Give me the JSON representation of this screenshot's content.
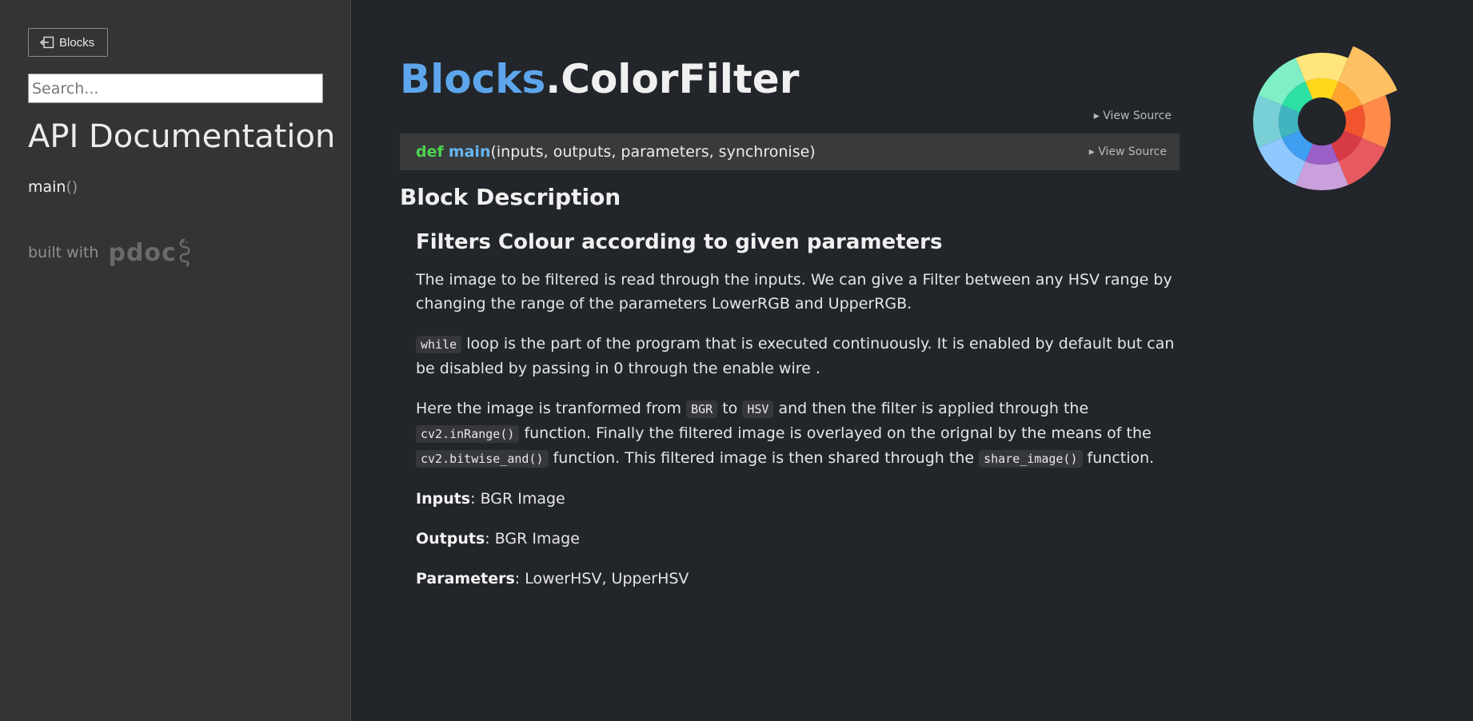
{
  "sidebar": {
    "back_label": "Blocks",
    "search_placeholder": "Search...",
    "title": "API Documentation",
    "nav_main": "main",
    "nav_main_parens": "()",
    "built_with": "built with",
    "logo_text": "pdoc"
  },
  "module": {
    "package": "Blocks",
    "dot": ".",
    "name": "ColorFilter",
    "view_source": "View Source"
  },
  "function": {
    "keyword": "def",
    "name": "main",
    "params": "(inputs, outputs, parameters, synchronise)",
    "view_source": "View Source"
  },
  "docs": {
    "section_title": "Block Description",
    "heading": "Filters Colour according to given parameters",
    "p1": "The image to be filtered is read through the inputs. We can give a Filter between any HSV range by changing the range of the parameters LowerRGB and UpperRGB.",
    "p2_code": "while",
    "p2_text": " loop is the part of the program that is executed continuously. It is enabled by default but can be disabled by passing in 0 through the enable wire .",
    "p3_a": "Here the image is tranformed from ",
    "p3_code1": "BGR",
    "p3_b": " to ",
    "p3_code2": "HSV",
    "p3_c": " and then the filter is applied through the ",
    "p3_code3": "cv2.inRange()",
    "p3_d": " function. Finally the filtered image is overlayed on the orignal by the means of the ",
    "p3_code4": "cv2.bitwise_and()",
    "p3_e": " function. This filtered image is then shared through the ",
    "p3_code5": "share_image()",
    "p3_f": " function.",
    "inputs_label": "Inputs",
    "inputs_value": ": BGR Image",
    "outputs_label": "Outputs",
    "outputs_value": ": BGR Image",
    "params_label": "Parameters",
    "params_value": ": LowerHSV, UpperHSV"
  },
  "colors": {
    "package": "#5ea6ec",
    "keyword": "#4ed34e",
    "function": "#66b6f0",
    "background": "#22252a",
    "sidebar": "#343435"
  }
}
